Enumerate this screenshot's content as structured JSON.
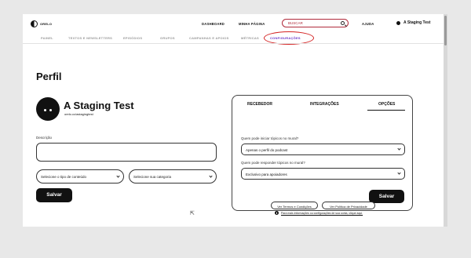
{
  "brand": {
    "logo_text": "ORELO"
  },
  "topnav": {
    "dashboard": "DASHBOARD",
    "my_page": "MINHA PÁGINA",
    "help": "AJUDA"
  },
  "search": {
    "placeholder": "BUSCAR"
  },
  "user": {
    "name": "A Staging Test"
  },
  "subnav": [
    {
      "label": "PAINEL"
    },
    {
      "label": "TEXTOS E NEWSLETTERS"
    },
    {
      "label": "EPISÓDIOS"
    },
    {
      "label": "GRUPOS"
    },
    {
      "label": "CAMPANHAS E APOIOS"
    },
    {
      "label": "MÉTRICAS"
    },
    {
      "label": "CONFIGURAÇÕES",
      "active": true
    }
  ],
  "profile": {
    "heading": "Perfil",
    "name": "A Staging Test",
    "url": "orelo.cc/astagingtest",
    "description_label": "Descrição",
    "description_value": "",
    "content_type_placeholder": "Selecione o tipo de conteúdo",
    "category_placeholder": "Selecione sua categoria",
    "save_label": "Salvar"
  },
  "options_panel": {
    "tabs": [
      "RECEBEDOR",
      "INTEGRAÇÕES",
      "OPÇÕES"
    ],
    "active_tab": "OPÇÕES",
    "question_topics": "Quem pode iniciar tópicos no mural?",
    "topics_value": "Apenas o perfil do podcast",
    "question_replies": "Quem pode responder tópicos no mural?",
    "replies_value": "Exclusivo para apoiadores",
    "save_label": "Salvar"
  },
  "footer_links": {
    "terms": "Ver Termos e Condições",
    "privacy": "Ver Política de Privacidade",
    "info_text": "Para mais informações ou configurações de sua conta, clique aqui."
  },
  "colors": {
    "accent": "#6a36c8",
    "search_border": "#b02a3a",
    "highlight": "#d42222"
  }
}
